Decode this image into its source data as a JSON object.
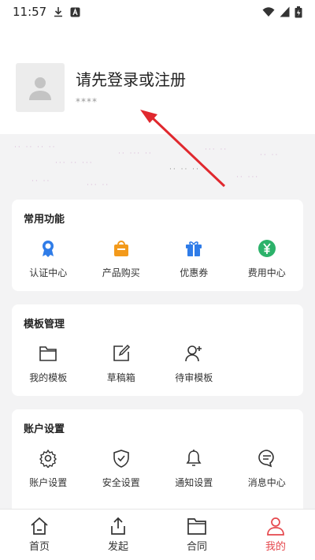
{
  "status_bar": {
    "time": "11:57"
  },
  "profile": {
    "title": "请先登录或注册",
    "subtitle": "****"
  },
  "sections": [
    {
      "title": "常用功能",
      "items": [
        {
          "label": "认证中心",
          "icon": "certificate-icon",
          "color": "#2f7ce8"
        },
        {
          "label": "产品购买",
          "icon": "shopping-bag-icon",
          "color": "#f39a1b"
        },
        {
          "label": "优惠券",
          "icon": "gift-icon",
          "color": "#2f7ce8"
        },
        {
          "label": "费用中心",
          "icon": "yen-icon",
          "color": "#2cb26a"
        }
      ]
    },
    {
      "title": "模板管理",
      "items": [
        {
          "label": "我的模板",
          "icon": "folder-icon"
        },
        {
          "label": "草稿箱",
          "icon": "edit-icon"
        },
        {
          "label": "待审模板",
          "icon": "user-add-icon"
        }
      ]
    },
    {
      "title": "账户设置",
      "items": [
        {
          "label": "账户设置",
          "icon": "gear-icon"
        },
        {
          "label": "安全设置",
          "icon": "shield-icon"
        },
        {
          "label": "通知设置",
          "icon": "bell-icon"
        },
        {
          "label": "消息中心",
          "icon": "message-icon"
        }
      ]
    }
  ],
  "tabbar": [
    {
      "label": "首页",
      "icon": "home-icon",
      "active": false
    },
    {
      "label": "发起",
      "icon": "share-icon",
      "active": false
    },
    {
      "label": "合同",
      "icon": "contract-folder-icon",
      "active": false
    },
    {
      "label": "我的",
      "icon": "person-icon",
      "active": true
    }
  ],
  "colors": {
    "accent": "#e5484d",
    "arrow": "#e0282e"
  }
}
